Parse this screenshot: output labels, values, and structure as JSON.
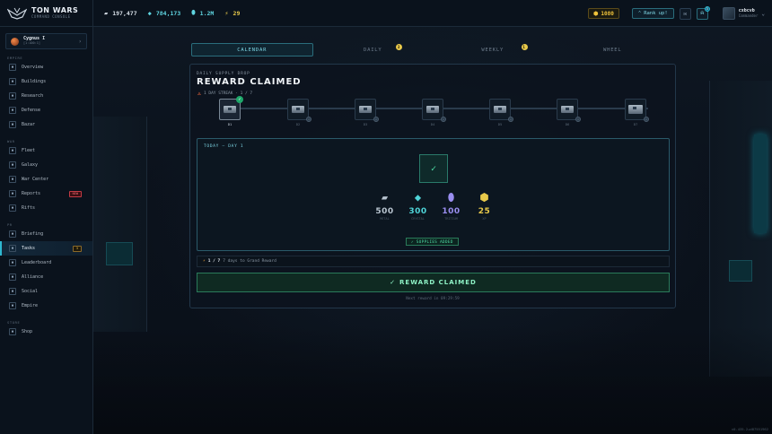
{
  "brand": {
    "name": "TON WARS",
    "subtitle": "COMMAND CONSOLE"
  },
  "resources": [
    {
      "icon": "metal-icon",
      "value": "197,477"
    },
    {
      "icon": "crystal-icon",
      "value": "784,173"
    },
    {
      "icon": "tritium-icon",
      "value": "1.2M"
    },
    {
      "icon": "energy-icon",
      "value": "29"
    }
  ],
  "topright": {
    "coins": "1080",
    "rank_up": "Rank up!",
    "notif_count": "3",
    "username": "cxbcvb",
    "user_sub": "Commander"
  },
  "planet": {
    "name": "Cygnus I",
    "coords": "[1:100:1]"
  },
  "sidebar": {
    "sections": [
      {
        "label": "EMPIRE",
        "items": [
          {
            "label": "Overview",
            "icon": "overview-icon"
          },
          {
            "label": "Buildings",
            "icon": "buildings-icon"
          },
          {
            "label": "Research",
            "icon": "research-icon"
          },
          {
            "label": "Defense",
            "icon": "defense-icon"
          },
          {
            "label": "Bazar",
            "icon": "bazar-icon"
          }
        ]
      },
      {
        "label": "WAR",
        "items": [
          {
            "label": "Fleet",
            "icon": "fleet-icon"
          },
          {
            "label": "Galaxy",
            "icon": "galaxy-icon"
          },
          {
            "label": "War Center",
            "icon": "war-center-icon"
          },
          {
            "label": "Reports",
            "icon": "reports-icon",
            "badge": "NEW"
          },
          {
            "label": "Rifts",
            "icon": "rifts-icon"
          }
        ]
      },
      {
        "label": "PR",
        "items": [
          {
            "label": "Briefing",
            "icon": "briefing-icon"
          },
          {
            "label": "Tasks",
            "icon": "tasks-icon",
            "badge": "3",
            "active": true
          },
          {
            "label": "Leaderboard",
            "icon": "leaderboard-icon"
          },
          {
            "label": "Alliance",
            "icon": "alliance-icon"
          },
          {
            "label": "Social",
            "icon": "social-icon"
          },
          {
            "label": "Empire",
            "icon": "empire-icon"
          }
        ]
      },
      {
        "label": "STORE",
        "items": [
          {
            "label": "Shop",
            "icon": "shop-icon"
          }
        ]
      }
    ]
  },
  "tabs": [
    {
      "label": "CALENDAR",
      "active": true
    },
    {
      "label": "DAILY",
      "dot": "3"
    },
    {
      "label": "WEEKLY",
      "dot": "1"
    },
    {
      "label": "WHEEL"
    }
  ],
  "panel": {
    "kicker": "DAILY SUPPLY DROP",
    "title": "REWARD CLAIMED",
    "streak": "1 DAY STREAK · 1 / 7",
    "days": [
      "D1",
      "D2",
      "D3",
      "D4",
      "D5",
      "D6",
      "D7"
    ],
    "today_label": "TODAY — DAY 1",
    "rewards": [
      {
        "icon": "metal-icon",
        "value": "500",
        "color": "#b8c4cf",
        "name": "METAL"
      },
      {
        "icon": "crystal-icon",
        "value": "300",
        "color": "#4fd4d8",
        "name": "CRYSTAL"
      },
      {
        "icon": "tritium-icon",
        "value": "100",
        "color": "#9a8ef0",
        "name": "TRITIUM"
      },
      {
        "icon": "cube-icon",
        "value": "25",
        "color": "#e8c94a",
        "name": "XP"
      }
    ],
    "supplies_added": "✓ SUPPLIES ADDED",
    "progress_value": "1 / 7",
    "progress_text": "7 days to Grand Reward",
    "claim_button": "REWARD CLAIMED",
    "next_reward": "Next reward in 09:29:59"
  },
  "version": "v0.435.2+d87551962"
}
